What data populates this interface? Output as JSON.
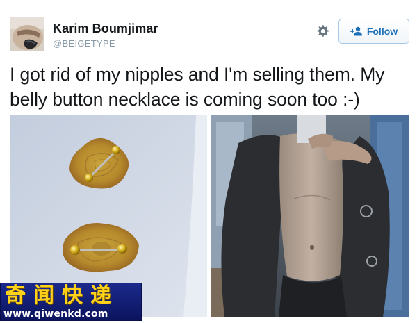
{
  "user": {
    "display_name": "Karim Boumjimar",
    "handle": "@BEIGETYPE"
  },
  "actions": {
    "follow_label": "Follow",
    "settings_icon": "gear-icon",
    "follow_icon": "add-user-icon"
  },
  "tweet": {
    "text": "I got rid of my nipples and I'm selling them. My belly button necklace is coming soon too :-)"
  },
  "watermark": {
    "chinese": "奇闻快递",
    "url": "www.qiwenkd.com"
  },
  "colors": {
    "accent": "#1d6fb8",
    "handle": "#8899a6",
    "text": "#14171a",
    "watermark_bg": "#1b2a8c",
    "watermark_text": "#ffd21a"
  }
}
